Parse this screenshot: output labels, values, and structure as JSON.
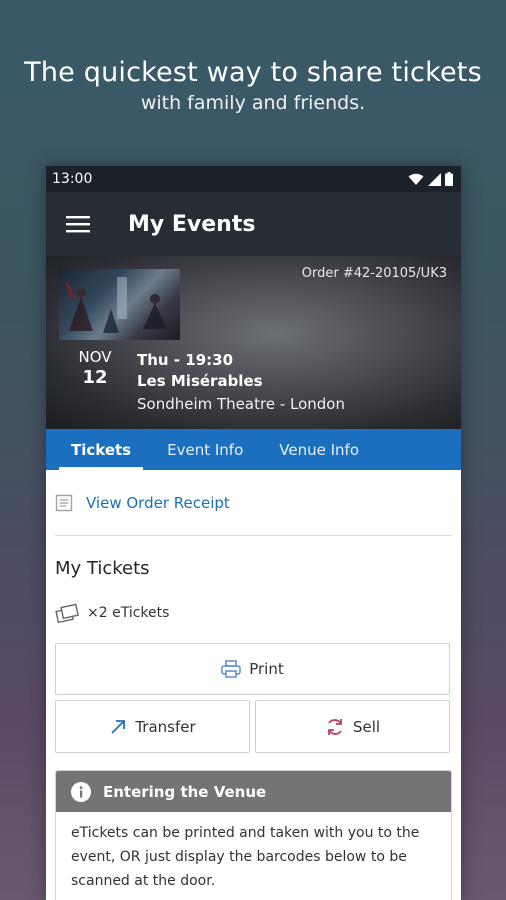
{
  "promo": {
    "headline": "The quickest way to share tickets",
    "subheadline": "with family and friends."
  },
  "status_bar": {
    "time": "13:00",
    "icons": [
      "wifi-icon",
      "signal-icon",
      "battery-icon"
    ]
  },
  "app_bar": {
    "menu_icon": "hamburger-menu-icon",
    "title": "My Events"
  },
  "event": {
    "order_number": "Order #42-20105/UK3",
    "month": "NOV",
    "day": "12",
    "time": "Thu - 19:30",
    "name": "Les Misérables",
    "venue": "Sondheim Theatre - London"
  },
  "tabs": [
    {
      "label": "Tickets",
      "active": true
    },
    {
      "label": "Event Info",
      "active": false
    },
    {
      "label": "Venue Info",
      "active": false
    }
  ],
  "receipt": {
    "label": "View Order Receipt",
    "icon": "receipt-icon"
  },
  "my_tickets": {
    "title": "My Tickets",
    "count_label": "×2 eTickets",
    "icon": "tickets-icon"
  },
  "actions": {
    "print_label": "Print",
    "transfer_label": "Transfer",
    "sell_label": "Sell"
  },
  "info_card": {
    "title": "Entering the Venue",
    "body": "eTickets can be printed and taken with you to the event, OR just display the barcodes below to be scanned at the door."
  },
  "colors": {
    "primary_blue": "#1a6fbf",
    "app_bar": "#262d35",
    "status_bar": "#1c2229",
    "sell_icon": "#c0425c",
    "info_header": "#747474"
  }
}
